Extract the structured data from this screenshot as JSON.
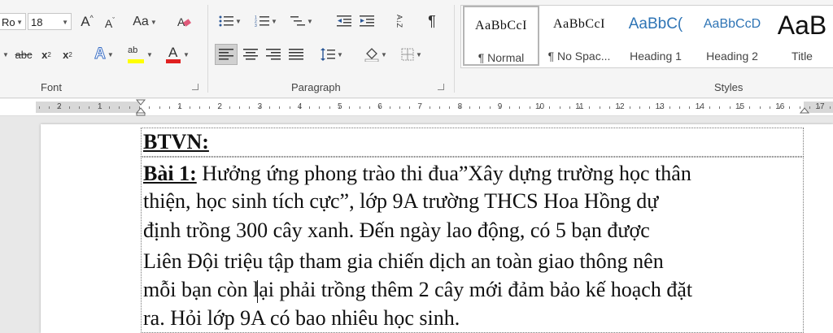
{
  "ribbon": {
    "font": {
      "label": "Font",
      "font_name": "Ro",
      "font_size": "18",
      "grow_glyph": "A",
      "shrink_glyph": "A",
      "case_label": "Aa",
      "strike_label": "abc",
      "sub_label": "x",
      "sub_mark": "2",
      "sup_label": "x",
      "sup_mark": "2",
      "effects_glyph": "A",
      "highlight_glyph": "ab",
      "fontcolor_glyph": "A"
    },
    "paragraph": {
      "label": "Paragraph",
      "sort_glyph": "A↓Z",
      "pilcrow": "¶"
    },
    "styles": {
      "label": "Styles",
      "items": [
        {
          "preview": "AaBbCcI",
          "name": "¶ Normal"
        },
        {
          "preview": "AaBbCcI",
          "name": "¶ No Spac..."
        },
        {
          "preview": "AaBbC(",
          "name": "Heading 1"
        },
        {
          "preview": "AaBbCcD",
          "name": "Heading 2"
        },
        {
          "preview": "AaB",
          "name": "Title"
        }
      ]
    }
  },
  "ruler": {
    "left_numbers": [
      "2",
      "1"
    ],
    "right_numbers": [
      "1",
      "2",
      "3",
      "4",
      "5",
      "6",
      "7",
      "8",
      "9",
      "10",
      "11",
      "12",
      "13",
      "14",
      "15",
      "16",
      "17"
    ]
  },
  "document": {
    "heading": "BTVN:",
    "exercise_label": "Bài 1:",
    "lines": [
      " Hưởng ứng phong trào thi đua”Xây dựng trường học thân",
      "thiện, học sinh tích cực”, lớp 9A trường THCS Hoa Hồng dự",
      "định trồng 300 cây xanh. Đến ngày lao động, có 5 bạn được",
      "Liên Đội triệu tập tham gia chiến dịch an toàn giao thông nên",
      "mỗi bạn còn lại phải trồng thêm 2 cây mới đảm bảo kế hoạch đặt",
      "ra. Hỏi lớp 9A có bao nhiêu học sinh."
    ]
  }
}
